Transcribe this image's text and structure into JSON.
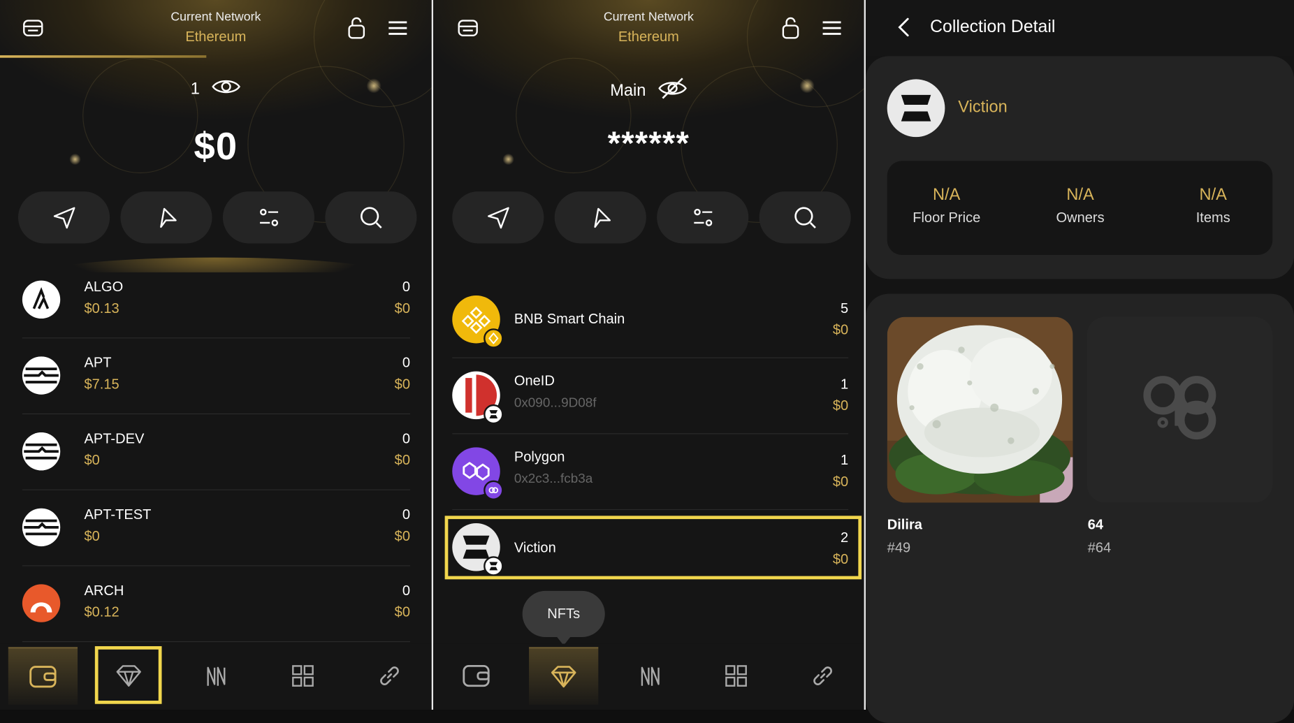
{
  "colors": {
    "accent": "#d8b45a",
    "highlight": "#f1d64d",
    "bg": "#151515",
    "card": "#232323"
  },
  "panel1": {
    "network_label": "Current Network",
    "network_value": "Ethereum",
    "account_name": "1",
    "balance": "$0",
    "tokens": [
      {
        "name": "ALGO",
        "price": "$0.13",
        "amount": "0",
        "value": "$0",
        "icon": "algorand-logo"
      },
      {
        "name": "APT",
        "price": "$7.15",
        "amount": "0",
        "value": "$0",
        "icon": "aptos-logo"
      },
      {
        "name": "APT-DEV",
        "price": "$0",
        "amount": "0",
        "value": "$0",
        "icon": "aptos-logo"
      },
      {
        "name": "APT-TEST",
        "price": "$0",
        "amount": "0",
        "value": "$0",
        "icon": "aptos-logo"
      },
      {
        "name": "ARCH",
        "price": "$0.12",
        "amount": "0",
        "value": "$0",
        "icon": "arch-logo"
      }
    ]
  },
  "panel2": {
    "network_label": "Current Network",
    "network_value": "Ethereum",
    "account_name": "Main",
    "balance": "******",
    "collections": [
      {
        "name": "BNB Smart Chain",
        "address": "",
        "count": "5",
        "value": "$0",
        "icon": "bnb-logo"
      },
      {
        "name": "OneID",
        "address": "0x090...9D08f",
        "count": "1",
        "value": "$0",
        "icon": "oneid-logo"
      },
      {
        "name": "Polygon",
        "address": "0x2c3...fcb3a",
        "count": "1",
        "value": "$0",
        "icon": "polygon-logo"
      },
      {
        "name": "Viction",
        "address": "",
        "count": "2",
        "value": "$0",
        "icon": "viction-logo"
      }
    ],
    "tooltip": "NFTs"
  },
  "panel3": {
    "title": "Collection Detail",
    "collection_name": "Viction",
    "stats": [
      {
        "value": "N/A",
        "label": "Floor Price"
      },
      {
        "value": "N/A",
        "label": "Owners"
      },
      {
        "value": "N/A",
        "label": "Items"
      }
    ],
    "nfts": [
      {
        "name": "Dilira",
        "id": "#49",
        "image": "white-flowers-photo"
      },
      {
        "name": "64",
        "id": "#64",
        "image": "placeholder-logo"
      }
    ]
  }
}
